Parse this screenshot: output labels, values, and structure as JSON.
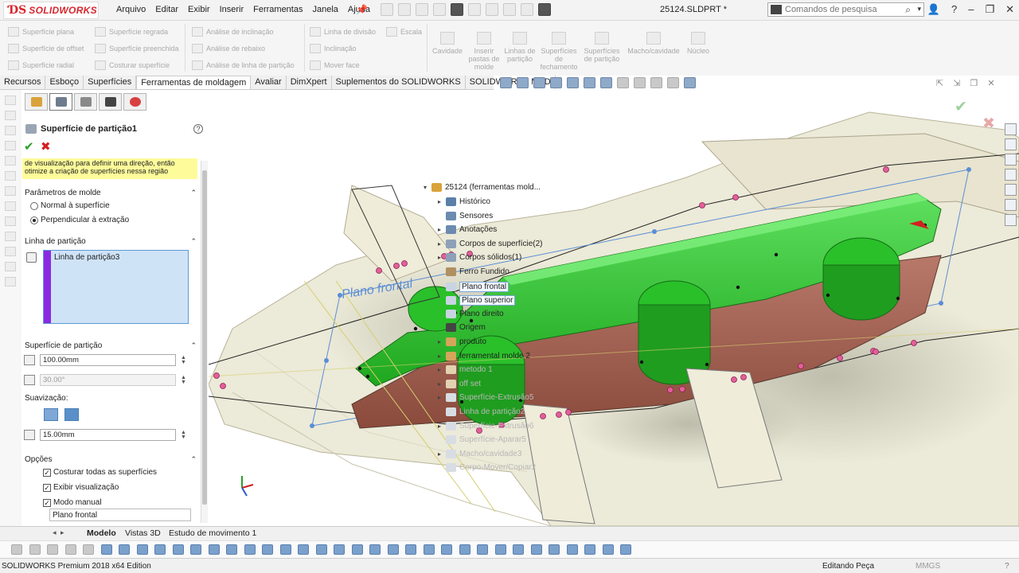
{
  "app": {
    "logo": "SOLIDWORKS",
    "document_title": "25124.SLDPRT *",
    "menus": [
      "Arquivo",
      "Editar",
      "Exibir",
      "Inserir",
      "Ferramentas",
      "Janela",
      "Ajuda"
    ],
    "search_placeholder": "Comandos de pesquisa"
  },
  "ribbon": {
    "col1": [
      "Superfície plana",
      "Superfície de offset",
      "Superfície radial"
    ],
    "col2": [
      "Superfície regrada",
      "Superfície preenchida",
      "Costurar superfície"
    ],
    "col3": [
      "Análise de inclinação",
      "Análise de rebaixo",
      "Análise de linha de partição"
    ],
    "col4": [
      "Linha de divisão",
      "Inclinação",
      "Mover face"
    ],
    "col4b": [
      "Escala"
    ],
    "big": [
      "Cavidade",
      "Inserir pastas de molde",
      "Linhas de partição",
      "Superfícies de fechamento",
      "Superfícies de partição",
      "Macho/cavidade",
      "Núcleo"
    ]
  },
  "tabs": [
    "Recursos",
    "Esboço",
    "Superfícies",
    "Ferramentas de moldagem",
    "Avaliar",
    "DimXpert",
    "Suplementos do SOLIDWORKS",
    "SOLIDWORKS MBD"
  ],
  "active_tab": "Ferramentas de moldagem",
  "pm": {
    "title": "Superfície de partição1",
    "message": "de visualização para definir uma direção, então otimize a criação de superfícies nessa região",
    "section_mold": "Parâmetros de molde",
    "radio_normal": "Normal à superfície",
    "radio_perp": "Perpendicular à extração",
    "section_pl": "Linha de partição",
    "pl_item": "Linha de partição3",
    "section_surf": "Superfície de partição",
    "distance": "100.00mm",
    "angle": "30.00°",
    "smoothing_label": "Suavização:",
    "smoothing_value": "15.00mm",
    "section_options": "Opções",
    "opt_knit": "Costurar todas as superfícies",
    "opt_preview": "Exibir visualização",
    "opt_manual": "Modo manual",
    "plane_field": "Plano frontal"
  },
  "tree": {
    "root": "25124  (ferramentas mold...",
    "items": [
      {
        "label": "Histórico",
        "exp": "▸",
        "dim": false,
        "color": "#5a7fa8"
      },
      {
        "label": "Sensores",
        "exp": "",
        "dim": false,
        "color": "#6b8bb0"
      },
      {
        "label": "Anotações",
        "exp": "▸",
        "dim": false,
        "color": "#6b8bb0"
      },
      {
        "label": "Corpos de superfície(2)",
        "exp": "▸",
        "dim": false,
        "color": "#8da0b8"
      },
      {
        "label": "Corpos sólidos(1)",
        "exp": "▸",
        "dim": false,
        "color": "#8da0b8"
      },
      {
        "label": "Ferro Fundido",
        "exp": "",
        "dim": false,
        "color": "#b09060"
      },
      {
        "label": "Plano frontal",
        "exp": "",
        "dim": false,
        "color": "#c8d4e2",
        "sel": true
      },
      {
        "label": "Plano superior",
        "exp": "",
        "dim": false,
        "color": "#c8d4e2",
        "sel": true
      },
      {
        "label": "Plano direito",
        "exp": "",
        "dim": false,
        "color": "#c8d4e2"
      },
      {
        "label": "Origem",
        "exp": "",
        "dim": false,
        "color": "#444444"
      },
      {
        "label": "produto",
        "exp": "▸",
        "dim": false,
        "color": "#d4a55a"
      },
      {
        "label": "ferramental molde 2",
        "exp": "▸",
        "dim": false,
        "color": "#d4a55a"
      },
      {
        "label": "metodo 1",
        "exp": "▸",
        "dim": true,
        "color": "#e2d2b0"
      },
      {
        "label": "off set",
        "exp": "▸",
        "dim": true,
        "color": "#e2d2b0"
      },
      {
        "label": "Superfície-Extrusão5",
        "exp": "▸",
        "dim": true,
        "color": "#d8dde4"
      },
      {
        "label": "Linha de partição2",
        "exp": "",
        "dim": true,
        "color": "#d8dde4"
      },
      {
        "label": "Superfície-Extrusão6",
        "exp": "▸",
        "dim": true,
        "color": "#d8dde4"
      },
      {
        "label": "Superfície-Aparar5",
        "exp": "",
        "dim": true,
        "color": "#d8dde4"
      },
      {
        "label": "Macho/cavidade3",
        "exp": "▸",
        "dim": true,
        "color": "#d8dde4"
      },
      {
        "label": "Corpo-Mover/Copiar2",
        "exp": "",
        "dim": true,
        "color": "#d8dde4"
      }
    ]
  },
  "viewport": {
    "plane_label": "Plano frontal",
    "colors": {
      "green": "#22c422",
      "brown": "#a05a4a",
      "beige": "#ebe6d2",
      "marker": "#e35f9a"
    }
  },
  "bottom_tabs": [
    "Modelo",
    "Vistas 3D",
    "Estudo de movimento 1"
  ],
  "status": {
    "left": "SOLIDWORKS Premium 2018 x64 Edition",
    "mode": "Editando Peça",
    "units": "MMGS"
  }
}
